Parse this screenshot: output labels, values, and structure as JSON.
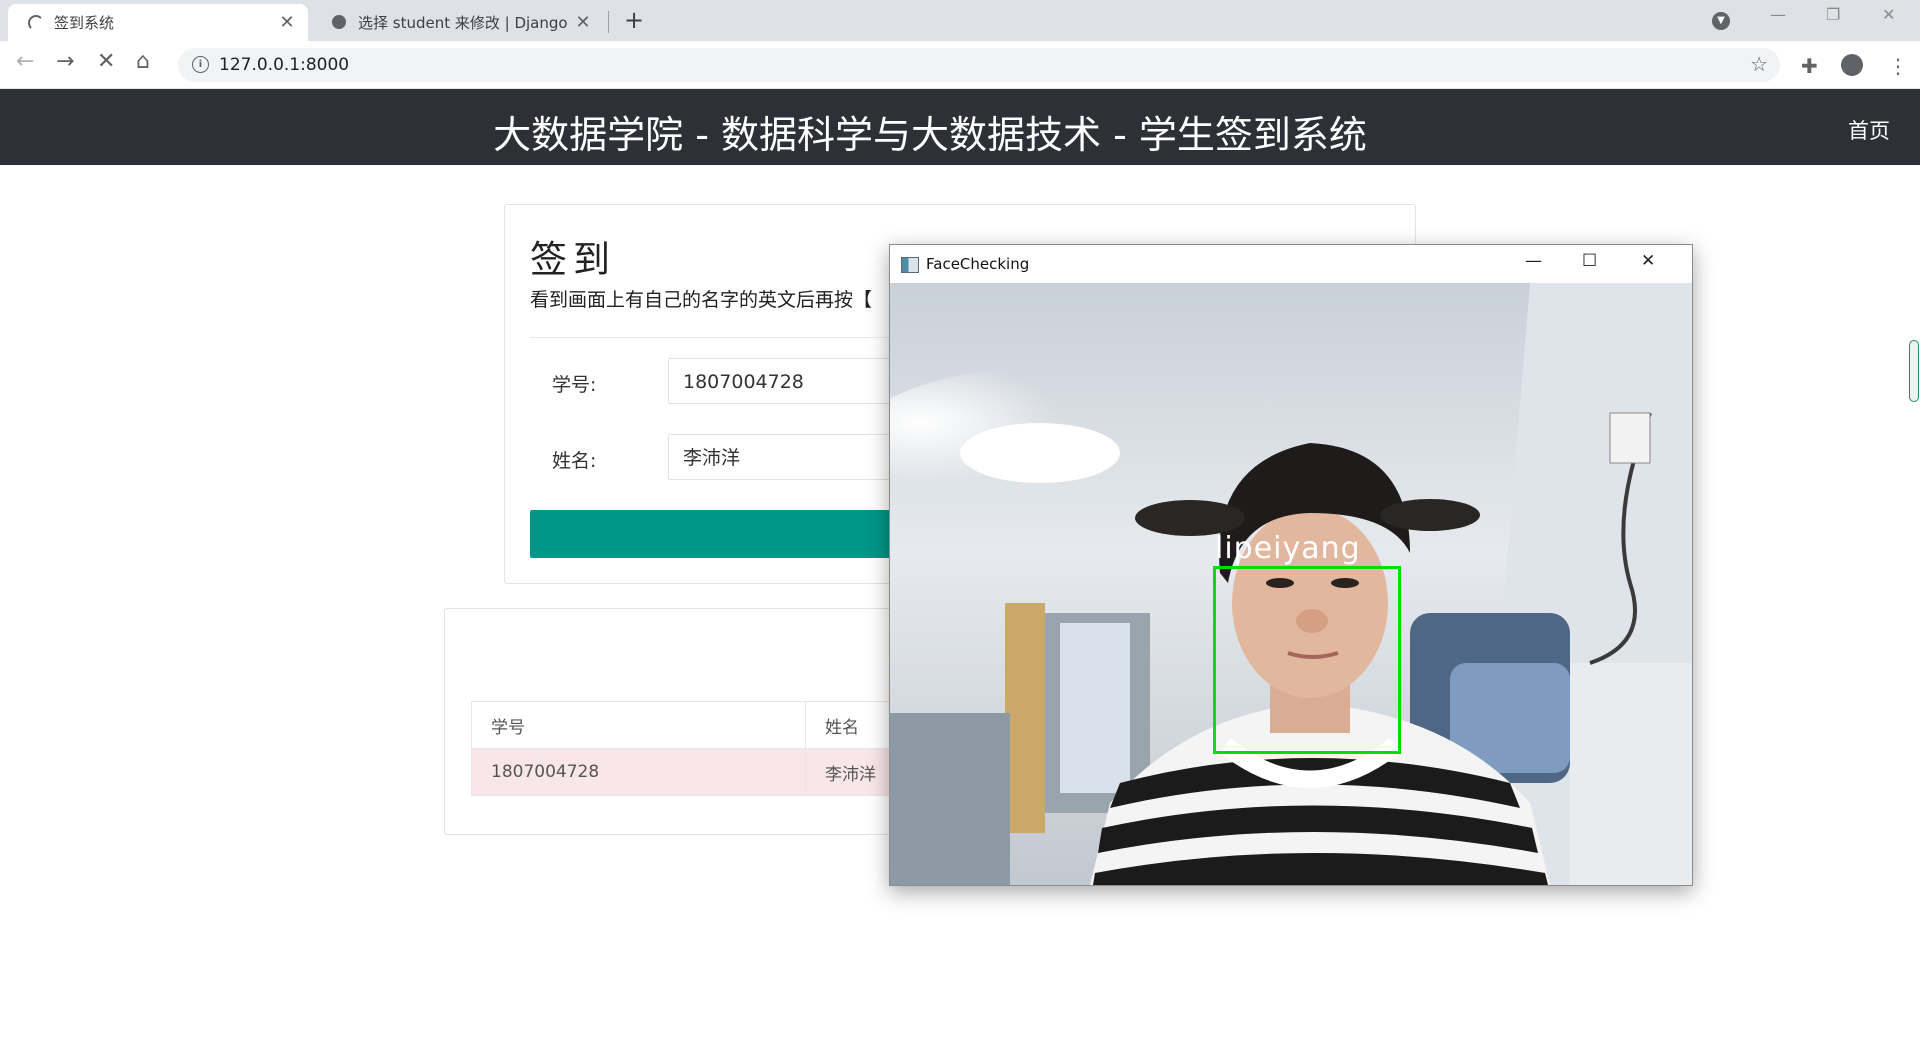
{
  "browser": {
    "tabs": [
      {
        "title": "签到系统",
        "close": "✕",
        "icon": "loading-spinner-icon"
      },
      {
        "title": "选择 student 来修改 | Django 站点管理",
        "close": "✕",
        "icon": "globe-icon"
      }
    ],
    "new_tab": "+",
    "url": "127.0.0.1:8000",
    "window_controls": {
      "minimize": "—",
      "restore": "❐",
      "close": "✕"
    }
  },
  "page": {
    "header_title": "大数据学院 - 数据科学与大数据技术 - 学生签到系统",
    "nav_home": "首页",
    "checkin": {
      "heading": "签到",
      "instruction": "看到画面上有自己的名字的英文后再按【",
      "student_id_label": "学号:",
      "student_id_value": "1807004728",
      "name_label": "姓名:",
      "name_value": "李沛洋",
      "accent_color": "#009688"
    },
    "table": {
      "headers": [
        "学号",
        "姓名"
      ],
      "rows": [
        [
          "1807004728",
          "李沛洋"
        ]
      ],
      "row_color": "#f8e6e9"
    }
  },
  "facewindow": {
    "title": "FaceChecking",
    "detected_name": "lipeiyang",
    "box_color": "#00e000"
  }
}
